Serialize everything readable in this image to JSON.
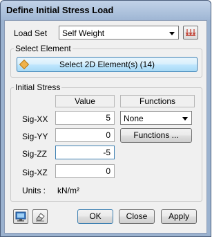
{
  "window": {
    "title": "Define Initial Stress Load"
  },
  "load_set": {
    "label": "Load Set",
    "value": "Self Weight",
    "icon": "load-set-icon"
  },
  "select_element": {
    "group_title": "Select Element",
    "button_label": "Select 2D Element(s) (14)"
  },
  "initial_stress": {
    "group_title": "Initial Stress",
    "value_header": "Value",
    "functions_header": "Functions",
    "rows": [
      {
        "label": "Sig-XX",
        "value": "5"
      },
      {
        "label": "Sig-YY",
        "value": "0"
      },
      {
        "label": "Sig-ZZ",
        "value": "-5"
      },
      {
        "label": "Sig-XZ",
        "value": "0"
      }
    ],
    "function_select_value": "None",
    "functions_button_label": "Functions ...",
    "units_label": "Units :",
    "units_value": "kN/m²"
  },
  "footer": {
    "ok_label": "OK",
    "close_label": "Close",
    "apply_label": "Apply"
  },
  "colors": {
    "accent": "#3c7fb1",
    "titlebar": "#9fb6d4"
  }
}
